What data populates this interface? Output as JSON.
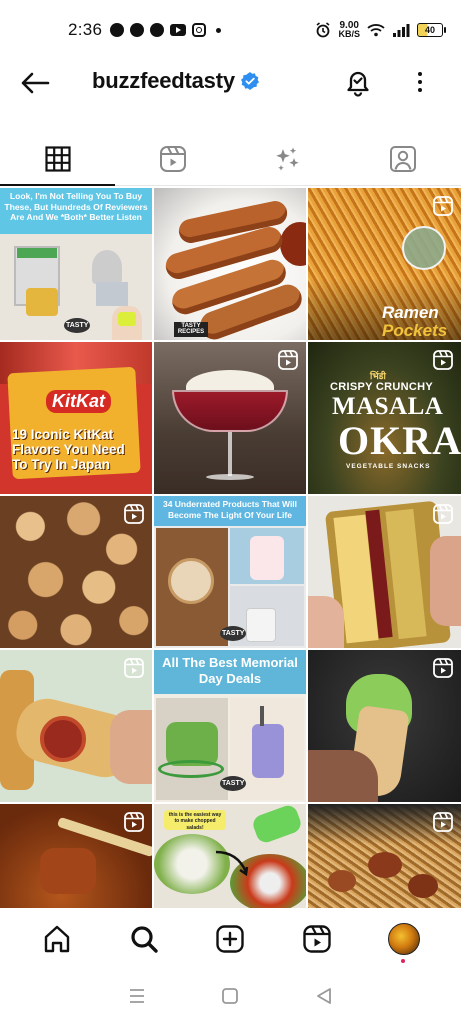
{
  "status_bar": {
    "time": "2:36",
    "net_speed_value": "9.00",
    "net_speed_unit": "KB/S",
    "battery": "40"
  },
  "header": {
    "username": "buzzfeedtasty"
  },
  "tabs": [
    {
      "name": "posts-grid",
      "active": true
    },
    {
      "name": "reels",
      "active": false
    },
    {
      "name": "effects",
      "active": false
    },
    {
      "name": "tagged",
      "active": false
    }
  ],
  "grid": {
    "tile_1": {
      "text": "Look, I'm Not Telling You To Buy These, But Hundreds Of Reviewers Are And We *Both* Better Listen",
      "logo": "TASTY"
    },
    "tile_2": {
      "logo": "TASTY RECIPES"
    },
    "tile_3": {
      "title": "Ramen",
      "subtitle": "Pockets"
    },
    "tile_4": {
      "brand": "KitKat",
      "title": "19 Iconic KitKat Flavors You Need To Try In Japan"
    },
    "tile_5": {},
    "tile_6": {
      "overline": "भिंडी",
      "line1": "CRISPY CRUNCHY",
      "line2": "MASALA",
      "line3": "OKRA",
      "line4": "VEGETABLE SNACKS"
    },
    "tile_7": {},
    "tile_8": {
      "text": "34 Underrated Products That Will Become The Light Of Your Life",
      "logo": "TASTY"
    },
    "tile_9": {},
    "tile_10": {},
    "tile_11": {
      "title": "All The Best Memorial Day Deals",
      "logo": "TASTY"
    },
    "tile_12": {},
    "tile_13": {},
    "tile_14": {
      "note": "this is the easiest way to make chopped salads!"
    },
    "tile_15": {}
  },
  "colors": {
    "accent_blue": "#3897f0",
    "verified_blue": "#2f8ff0",
    "text": "#111111",
    "notification_red": "#e0245e"
  },
  "icons": {
    "back": "back-arrow-icon",
    "verified": "verified-badge-icon",
    "bell": "notification-bell-icon",
    "more": "more-options-icon",
    "reel": "reel-icon",
    "home": "home-icon",
    "search": "search-icon",
    "create": "create-plus-icon",
    "reels_nav": "reels-icon",
    "profile": "profile-avatar"
  }
}
